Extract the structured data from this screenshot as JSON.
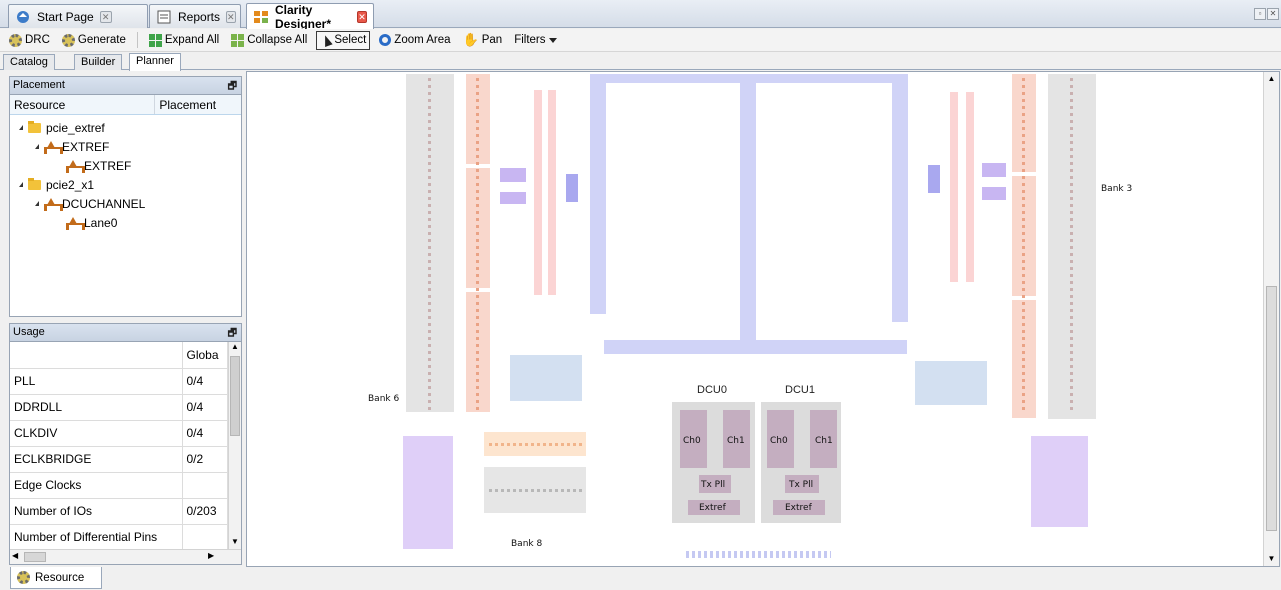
{
  "doc_tabs": [
    {
      "label": "Start Page",
      "icon": "start-page-icon"
    },
    {
      "label": "Reports",
      "icon": "reports-icon"
    },
    {
      "label": "Clarity Designer*",
      "icon": "clarity-designer-icon"
    }
  ],
  "toolbar": {
    "drc": "DRC",
    "generate": "Generate",
    "expand_all": "Expand All",
    "collapse_all": "Collapse All",
    "select": "Select",
    "zoom_area": "Zoom Area",
    "pan": "Pan",
    "filters": "Filters"
  },
  "view_tabs": [
    "Catalog",
    "Builder",
    "Planner"
  ],
  "placement": {
    "title": "Placement",
    "columns": [
      "Resource",
      "Placement"
    ],
    "tree": [
      {
        "label": "pcie_extref",
        "level": 0,
        "type": "folder"
      },
      {
        "label": "EXTREF",
        "level": 1,
        "type": "resource"
      },
      {
        "label": "EXTREF",
        "level": 2,
        "type": "resource"
      },
      {
        "label": "pcie2_x1",
        "level": 0,
        "type": "folder"
      },
      {
        "label": "DCUCHANNEL",
        "level": 1,
        "type": "resource"
      },
      {
        "label": "Lane0",
        "level": 2,
        "type": "resource"
      }
    ]
  },
  "usage": {
    "title": "Usage",
    "column": "Globa",
    "rows": [
      {
        "name": "PLL",
        "value": "0/4"
      },
      {
        "name": "DDRDLL",
        "value": "0/4"
      },
      {
        "name": "CLKDIV",
        "value": "0/4"
      },
      {
        "name": "ECLKBRIDGE",
        "value": "0/2"
      },
      {
        "name": "Edge Clocks",
        "value": ""
      },
      {
        "name": "Number of IOs",
        "value": "0/203"
      },
      {
        "name": "Number of Differential Pins",
        "value": ""
      }
    ]
  },
  "bottom_tab": "Resource",
  "canvas": {
    "bank6": "Bank 6",
    "bank3": "Bank 3",
    "bank8": "Bank 8",
    "dcu0": {
      "title": "DCU0",
      "ch0": "Ch0",
      "ch1": "Ch1",
      "txpll": "Tx Pll",
      "extref": "Extref"
    },
    "dcu1": {
      "title": "DCU1",
      "ch0": "Ch0",
      "ch1": "Ch1",
      "txpll": "Tx Pll",
      "extref": "Extref"
    }
  }
}
